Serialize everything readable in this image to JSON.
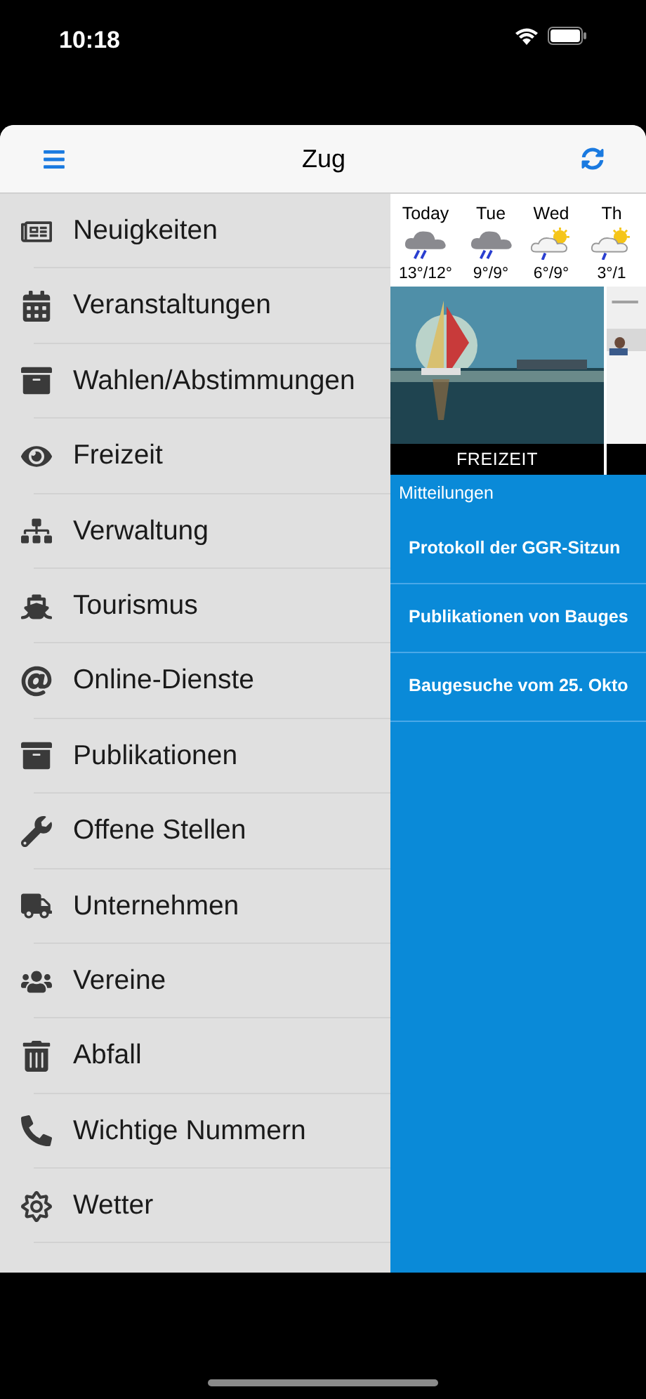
{
  "status_bar": {
    "time": "10:18"
  },
  "header": {
    "title": "Zug"
  },
  "menu": [
    {
      "label": "Neuigkeiten"
    },
    {
      "label": "Veranstaltungen"
    },
    {
      "label": "Wahlen/Abstimmungen"
    },
    {
      "label": "Freizeit"
    },
    {
      "label": "Verwaltung"
    },
    {
      "label": "Tourismus"
    },
    {
      "label": "Online-Dienste"
    },
    {
      "label": "Publikationen"
    },
    {
      "label": "Offene Stellen"
    },
    {
      "label": "Unternehmen"
    },
    {
      "label": "Vereine"
    },
    {
      "label": "Abfall"
    },
    {
      "label": "Wichtige Nummern"
    },
    {
      "label": "Wetter"
    }
  ],
  "weather": [
    {
      "day": "Today",
      "temp": "13°/12°",
      "kind": "rain"
    },
    {
      "day": "Tue",
      "temp": "9°/9°",
      "kind": "rain"
    },
    {
      "day": "Wed",
      "temp": "6°/9°",
      "kind": "sunshower"
    },
    {
      "day": "Th",
      "temp": "3°/1",
      "kind": "sunshower"
    }
  ],
  "tiles": [
    {
      "caption": "FREIZEIT",
      "kind": "picture"
    },
    {
      "kind": "picture"
    }
  ],
  "news": {
    "title": "Mitteilungen",
    "items": [
      "Protokoll der GGR-Sitzun",
      "Publikationen von Bauges",
      "Baugesuche vom 25. Okto"
    ]
  }
}
